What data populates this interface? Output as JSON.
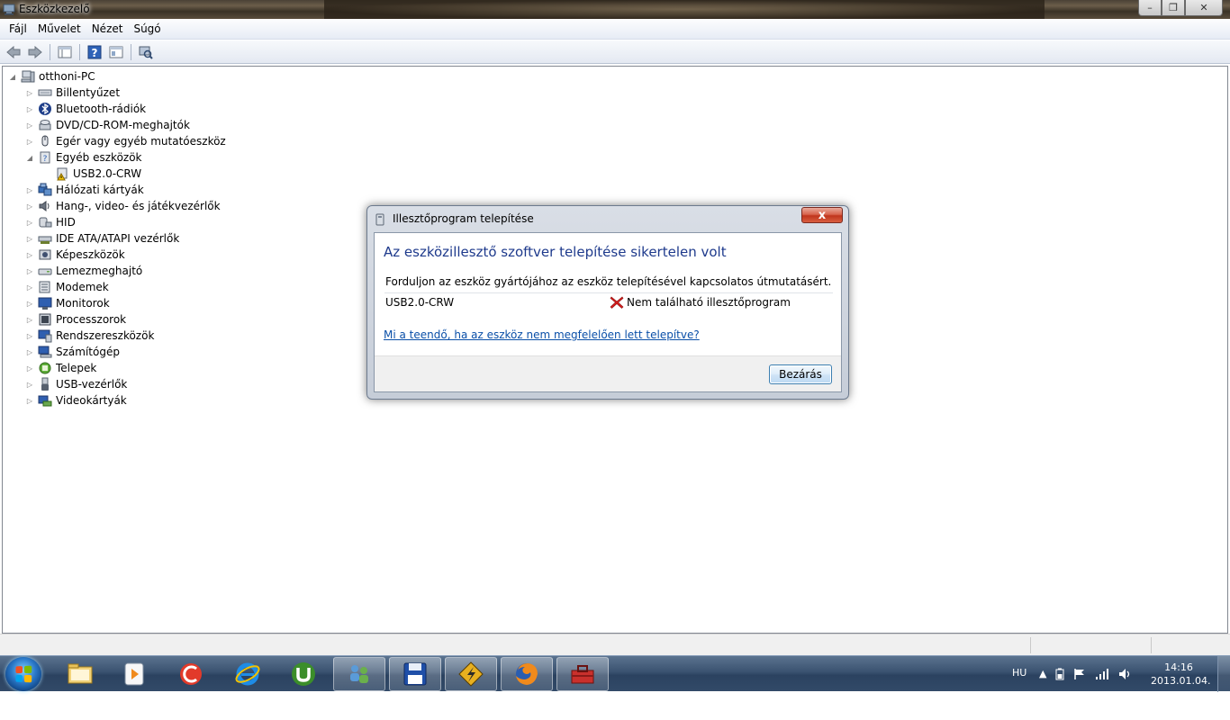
{
  "window": {
    "title": "Eszközkezelő",
    "buttons": {
      "minimize": "–",
      "maximize": "❐",
      "close": "✕"
    }
  },
  "menu": [
    {
      "label": "Fájl"
    },
    {
      "label": "Művelet"
    },
    {
      "label": "Nézet"
    },
    {
      "label": "Súgó"
    }
  ],
  "toolbar": {
    "icons": [
      "back-arrow-icon",
      "forward-arrow-icon",
      "show-hide-console-tree-icon",
      "help-icon",
      "properties-icon",
      "scan-hardware-icon"
    ]
  },
  "tree": {
    "root": "otthoni-PC",
    "items": [
      {
        "label": "Billentyűzet",
        "icon": "keyboard-icon",
        "expander": "▷"
      },
      {
        "label": "Bluetooth-rádiók",
        "icon": "bluetooth-icon",
        "expander": "▷"
      },
      {
        "label": "DVD/CD-ROM-meghajtók",
        "icon": "dvd-drive-icon",
        "expander": "▷"
      },
      {
        "label": "Egér vagy egyéb mutatóeszköz",
        "icon": "mouse-icon",
        "expander": "▷"
      },
      {
        "label": "Egyéb eszközök",
        "icon": "unknown-device-icon",
        "expander": "◢"
      },
      {
        "label": "Hálózati kártyák",
        "icon": "network-adapter-icon",
        "expander": "▷"
      },
      {
        "label": "Hang-, video- és játékvezérlők",
        "icon": "speaker-icon",
        "expander": "▷"
      },
      {
        "label": "HID",
        "icon": "hid-icon",
        "expander": "▷"
      },
      {
        "label": "IDE ATA/ATAPI vezérlők",
        "icon": "ide-controller-icon",
        "expander": "▷"
      },
      {
        "label": "Képeszközök",
        "icon": "imaging-device-icon",
        "expander": "▷"
      },
      {
        "label": "Lemezmeghajtó",
        "icon": "disk-drive-icon",
        "expander": "▷"
      },
      {
        "label": "Modemek",
        "icon": "modem-icon",
        "expander": "▷"
      },
      {
        "label": "Monitorok",
        "icon": "monitor-icon",
        "expander": "▷"
      },
      {
        "label": "Processzorok",
        "icon": "processor-icon",
        "expander": "▷"
      },
      {
        "label": "Rendszereszközök",
        "icon": "system-device-icon",
        "expander": "▷"
      },
      {
        "label": "Számítógép",
        "icon": "computer-icon",
        "expander": "▷"
      },
      {
        "label": "Telepek",
        "icon": "battery-icon",
        "expander": "▷"
      },
      {
        "label": "USB-vezérlők",
        "icon": "usb-icon",
        "expander": "▷"
      },
      {
        "label": "Videokártyák",
        "icon": "display-adapter-icon",
        "expander": "▷"
      }
    ],
    "child": {
      "label": "USB2.0-CRW",
      "icon": "warning-device-icon"
    }
  },
  "dialog": {
    "title": "Illesztőprogram telepítése",
    "heading": "Az eszközillesztő szoftver telepítése sikertelen volt",
    "message": "Forduljon az eszköz gyártójához az eszköz telepítésével kapcsolatos útmutatásért.",
    "device": "USB2.0-CRW",
    "error": "Nem található illesztőprogram",
    "link": "Mi a teendő, ha az eszköz nem megfelelően lett telepítve?",
    "close_button": "Bezárás",
    "close_x": "x"
  },
  "taskbar": {
    "apps": [
      "explorer-icon",
      "media-player-icon",
      "ccleaner-icon",
      "internet-explorer-icon",
      "utorrent-icon",
      "network-users-icon",
      "floppy-save-icon",
      "winamp-icon",
      "firefox-icon",
      "toolbox-icon"
    ],
    "language": "HU",
    "tray_up": "▲",
    "time": "14:16",
    "date": "2013.01.04."
  },
  "colors": {
    "dialog_heading": "#1e3a8c",
    "link": "#0a4fa8",
    "error_x": "#d81e1e"
  }
}
